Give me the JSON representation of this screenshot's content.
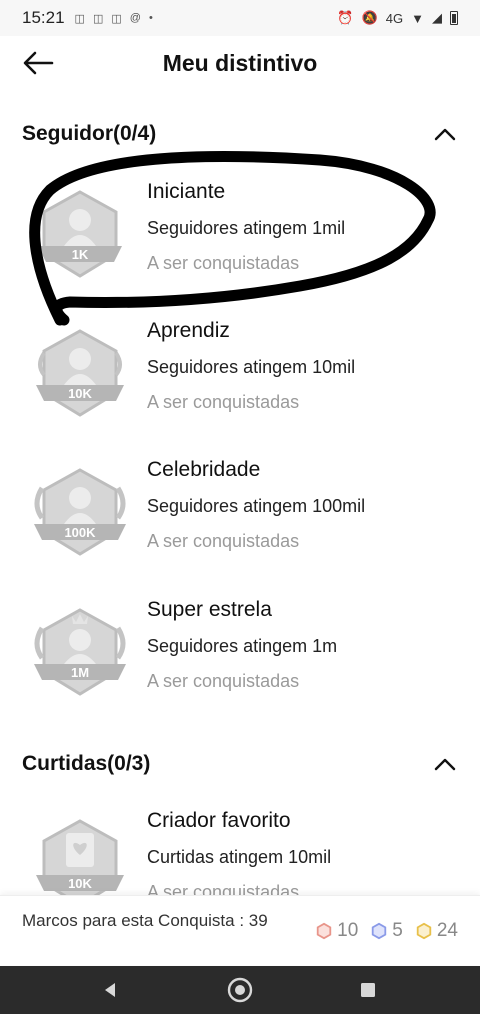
{
  "status_bar": {
    "time": "15:21",
    "network_label": "4G"
  },
  "header": {
    "title": "Meu distintivo"
  },
  "sections": [
    {
      "title": "Seguidor(0/4)",
      "items": [
        {
          "name": "Iniciante",
          "requirement": "Seguidores atingem 1mil",
          "status": "A ser conquistadas",
          "badge_label": "1K"
        },
        {
          "name": "Aprendiz",
          "requirement": "Seguidores atingem 10mil",
          "status": "A ser conquistadas",
          "badge_label": "10K"
        },
        {
          "name": "Celebridade",
          "requirement": "Seguidores atingem 100mil",
          "status": "A ser conquistadas",
          "badge_label": "100K"
        },
        {
          "name": "Super estrela",
          "requirement": "Seguidores atingem 1m",
          "status": "A ser conquistadas",
          "badge_label": "1M"
        }
      ]
    },
    {
      "title": "Curtidas(0/3)",
      "items": [
        {
          "name": "Criador favorito",
          "requirement": "Curtidas atingem 10mil",
          "status": "A ser conquistadas",
          "badge_label": "10K"
        }
      ]
    }
  ],
  "footer": {
    "milestone_label": "Marcos para esta Conquista : 39",
    "points": [
      {
        "value": "10",
        "color": "#e8958a",
        "icon": "hexagon-red-icon"
      },
      {
        "value": "5",
        "color": "#8a9ae8",
        "icon": "hexagon-blue-icon"
      },
      {
        "value": "24",
        "color": "#e8c04a",
        "icon": "hexagon-gold-icon"
      }
    ]
  },
  "colors": {
    "text_primary": "#111111",
    "text_muted": "#9a9a9a",
    "nav_bar": "#2b2b2b",
    "badge_gray": "#b8b8b8"
  }
}
